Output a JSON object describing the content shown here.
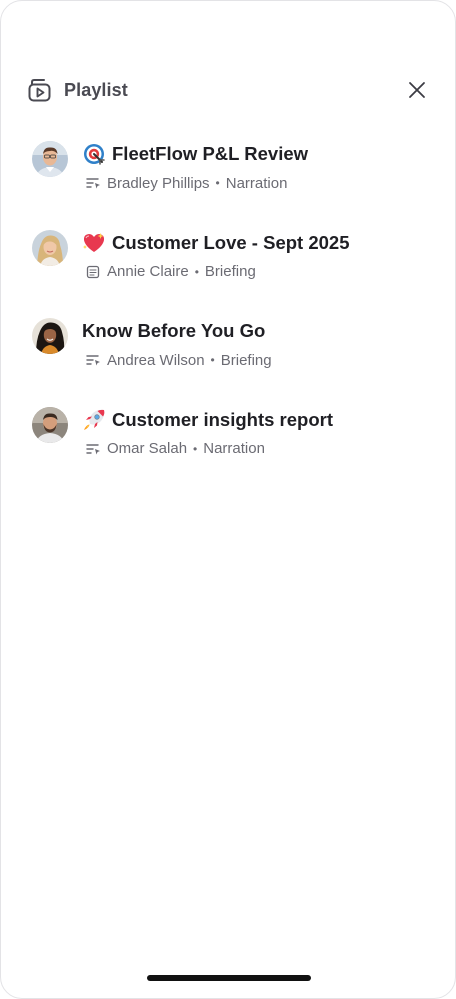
{
  "header": {
    "title": "Playlist",
    "icon": "playlist-play-icon",
    "close_icon": "close-icon"
  },
  "items": [
    {
      "emoji": "target-emoji",
      "title": "FleetFlow P&L Review",
      "author": "Bradley Phillips",
      "type": "Narration",
      "type_icon": "narration-icon"
    },
    {
      "emoji": "heart-emoji",
      "title": "Customer Love - Sept 2025",
      "author": "Annie Claire",
      "type": "Briefing",
      "type_icon": "document-icon"
    },
    {
      "emoji": "",
      "title": "Know Before You Go",
      "author": "Andrea Wilson",
      "type": "Briefing",
      "type_icon": "narration-icon"
    },
    {
      "emoji": "rocket-emoji",
      "title": "Customer insights report",
      "author": "Omar Salah",
      "type": "Narration",
      "type_icon": "narration-icon"
    }
  ],
  "separator": "•",
  "colors": {
    "title_text": "#1f1f24",
    "meta_text": "#6b6b73",
    "header_text": "#4a4a52"
  }
}
